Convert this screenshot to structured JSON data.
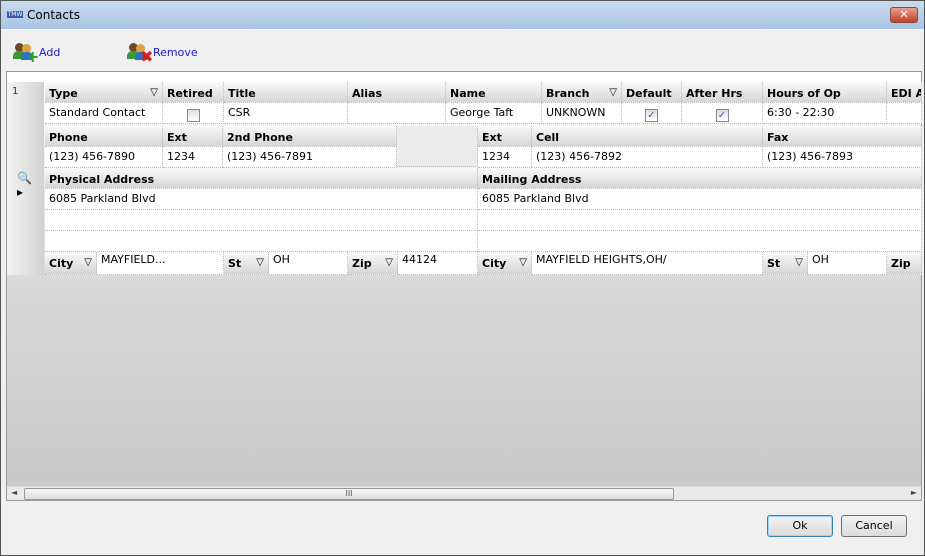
{
  "window": {
    "title": "Contacts",
    "app_icon": "TMW",
    "close": "✕"
  },
  "toolbar": {
    "add": "Add",
    "remove": "Remove"
  },
  "row_number": "1",
  "row1": {
    "headers": [
      "Type",
      "Retired",
      "Title",
      "Alias",
      "Name",
      "Branch",
      "Default",
      "After Hrs",
      "Hours of Op",
      "EDI A"
    ],
    "values": {
      "type": "Standard Contact",
      "retired": false,
      "title": "CSR",
      "alias": "",
      "name": "George Taft",
      "branch": "UNKNOWN",
      "default": true,
      "after_hrs": true,
      "hours": "6:30 - 22:30"
    }
  },
  "row2": {
    "headers": [
      "Phone",
      "Ext",
      "2nd Phone",
      "Ext",
      "Cell",
      "Fax"
    ],
    "values": [
      "(123) 456-7890",
      "1234",
      "(123) 456-7891",
      "1234",
      "(123) 456-7892",
      "(123) 456-7893"
    ]
  },
  "row3": {
    "physical_label": "Physical Address",
    "mailing_label": "Mailing Address",
    "physical": "6085 Parkland Blvd",
    "mailing": "6085 Parkland Blvd"
  },
  "row4": {
    "city_label": "City",
    "st_label": "St",
    "zip_label": "Zip",
    "phys_city": "MAYFIELD...",
    "phys_st": "OH",
    "phys_zip": "44124",
    "mail_city": "MAYFIELD HEIGHTS,OH/",
    "mail_st": "OH"
  },
  "scroll": {
    "grip": "III",
    "left": "◄",
    "right": "►"
  },
  "buttons": {
    "ok": "Ok",
    "cancel": "Cancel"
  }
}
